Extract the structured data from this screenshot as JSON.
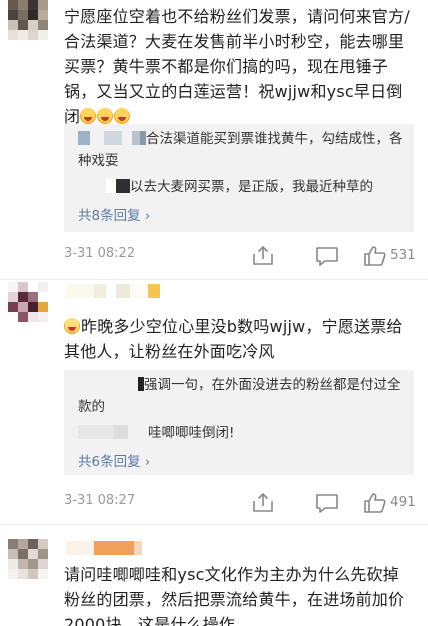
{
  "comments": [
    {
      "text": "宁愿座位空着也不给粉丝们发票，请问何来官方/合法渠道？大麦在发售前半小时秒空，能去哪里买票？黄牛票不都是你们搞的吗，现在甩锤子锅，又当又立的白莲运营！祝wjjw和ysc早日倒闭",
      "replies": [
        {
          "text": "合法渠道能买到票谁找黄牛，勾结成性，各种戏耍"
        },
        {
          "text": "以去大麦网买票，是正版，我最近种草的"
        }
      ],
      "more_label": "共8条回复",
      "time": "3-31 08:22",
      "like_count": "531"
    },
    {
      "text": "昨晚多少空位心里没b数吗wjjw，宁愿送票给其他人，让粉丝在外面吃冷风",
      "replies": [
        {
          "text": "强调一句，在外面没进去的粉丝都是付过全款的"
        },
        {
          "text": "哇唧唧哇倒闭!"
        }
      ],
      "more_label": "共6条回复",
      "time": "3-31 08:27",
      "like_count": "491"
    },
    {
      "text": "请问哇唧唧哇和ysc文化作为主办为什么先砍掉粉丝的团票，然后把票流给黄牛，在进场前加价2000块，这是什么操作"
    }
  ],
  "icons": [
    "share-icon",
    "comment-icon",
    "like-icon",
    "emoji-icon"
  ],
  "colors": {
    "link": "#5b7ca6",
    "reply_bg": "#f2f2f2",
    "meta": "#999999"
  }
}
